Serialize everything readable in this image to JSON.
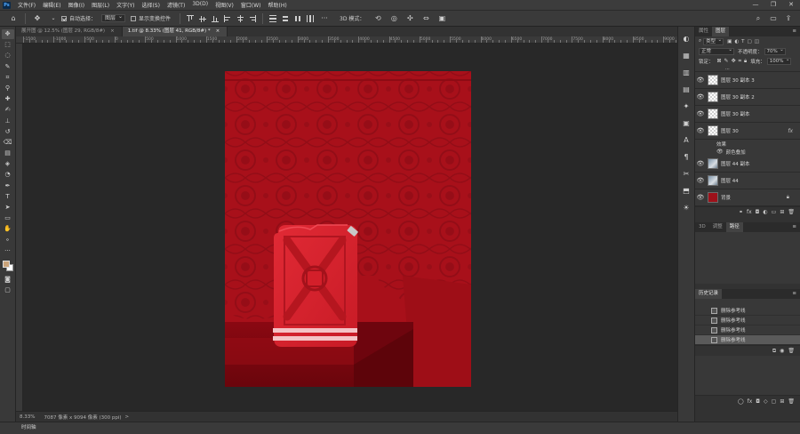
{
  "app": {
    "logo": "Ps"
  },
  "menubar": {
    "items": [
      "文件(F)",
      "编辑(E)",
      "图像(I)",
      "图层(L)",
      "文字(Y)",
      "选择(S)",
      "滤镜(T)",
      "3D(D)",
      "视图(V)",
      "窗口(W)",
      "帮助(H)"
    ]
  },
  "options": {
    "auto_select_label": "自动选择：",
    "auto_select_value": "图层",
    "show_transform_label": "显示变换控件",
    "three_d_mode_label": "3D 模式："
  },
  "tabs": [
    {
      "label": "展开图 @ 12.5% (图层 29, RGB/8#)",
      "close": "×"
    },
    {
      "label": "1.tif @ 8.33% (图层 41, RGB/8#) *",
      "close": "×"
    }
  ],
  "ruler": {
    "labels": [
      "-1500",
      "-1000",
      "-500",
      "0",
      "500",
      "1000",
      "1500",
      "2000",
      "2500",
      "3000",
      "3500",
      "4000",
      "4500",
      "5000",
      "5500",
      "6000",
      "6500",
      "7000",
      "7500",
      "8000",
      "8500",
      "9000",
      "9500"
    ]
  },
  "status": {
    "zoom": "8.33%",
    "doc_size": "7087 像素 x 9094 像素 (300 ppi)",
    "arrow": ">"
  },
  "timeline": {
    "label": "时间轴"
  },
  "layers_panel": {
    "tabs": [
      "属性",
      "图层"
    ],
    "kind_label": "类型",
    "blend_mode": "正常",
    "opacity_label": "不透明度：",
    "opacity_value": "70%",
    "lock_label": "锁定：",
    "fill_label": "填充：",
    "fill_value": "100%",
    "partial_layer": "...",
    "layers": [
      {
        "name": "图层 30 副本 3",
        "thumb": "transparent"
      },
      {
        "name": "图层 30 副本 2",
        "thumb": "transparent"
      },
      {
        "name": "图层 30 副本",
        "thumb": "transparent"
      },
      {
        "name": "图层 30",
        "thumb": "transparent",
        "fx": "fx"
      },
      {
        "name": "图层 44 副本",
        "thumb": "photo"
      },
      {
        "name": "图层 44",
        "thumb": "photo"
      },
      {
        "name": "背景",
        "thumb": "red"
      }
    ],
    "effects_label": "效果",
    "effect_item": "颜色叠加"
  },
  "mid_panel": {
    "tabs": [
      "3D",
      "调整",
      "路径"
    ]
  },
  "history_panel": {
    "title": "历史记录",
    "items": [
      "删除参考线",
      "删除参考线",
      "删除参考线",
      "删除参考线"
    ]
  },
  "colors": {
    "canvas_red": "#a8101a",
    "can_red": "#d7222d",
    "stripe": "#f2b8bc"
  }
}
